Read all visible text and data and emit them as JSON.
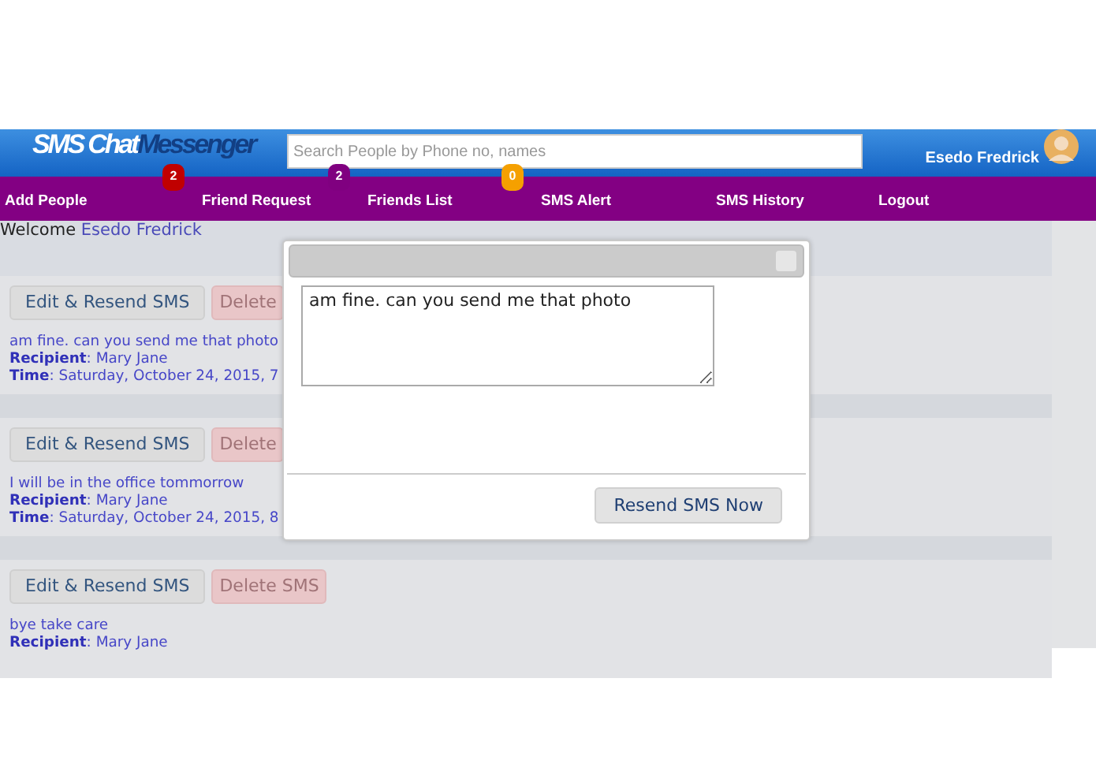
{
  "logo": [
    {
      "text": "SMS Chat",
      "kind": "light"
    },
    {
      "text": "Messenger",
      "kind": "dark"
    }
  ],
  "search": {
    "placeholder": "Search People by Phone no, names"
  },
  "user": {
    "name": "Esedo Fredrick"
  },
  "nav": [
    {
      "label": "Add People"
    },
    {
      "label": "Friend Request",
      "badge": "2",
      "color": "#c00000"
    },
    {
      "label": "Friends List",
      "badge": "2",
      "color": "#800080"
    },
    {
      "label": "SMS Alert",
      "badge": "0",
      "color": "#f5a000"
    },
    {
      "label": "SMS History"
    },
    {
      "label": "Logout"
    }
  ],
  "welcome": {
    "text": "Welcome",
    "name": "Esedo Fredrick"
  },
  "messages": [
    {
      "edit_button": "Edit & Resend SMS",
      "delete_button": "Delete",
      "text": "am fine. can you send me that photo",
      "recipient_label": "Recipient",
      "recipient": ": Mary Jane",
      "time_label": "Time",
      "time": ": Saturday, October 24, 2015, 7"
    },
    {
      "edit_button": "Edit & Resend SMS",
      "delete_button": "Delete",
      "text": "I will be in the office tommorrow",
      "recipient_label": "Recipient",
      "recipient": ": Mary Jane",
      "time_label": "Time",
      "time": ": Saturday, October 24, 2015, 8"
    },
    {
      "edit_button": "Edit & Resend SMS",
      "delete_button": "Delete SMS",
      "text": "bye take care",
      "recipient_label": "Recipient",
      "recipient": ": Mary Jane"
    }
  ],
  "dialog": {
    "message": "am fine. can you send me that photo",
    "button": "Resend SMS Now"
  }
}
